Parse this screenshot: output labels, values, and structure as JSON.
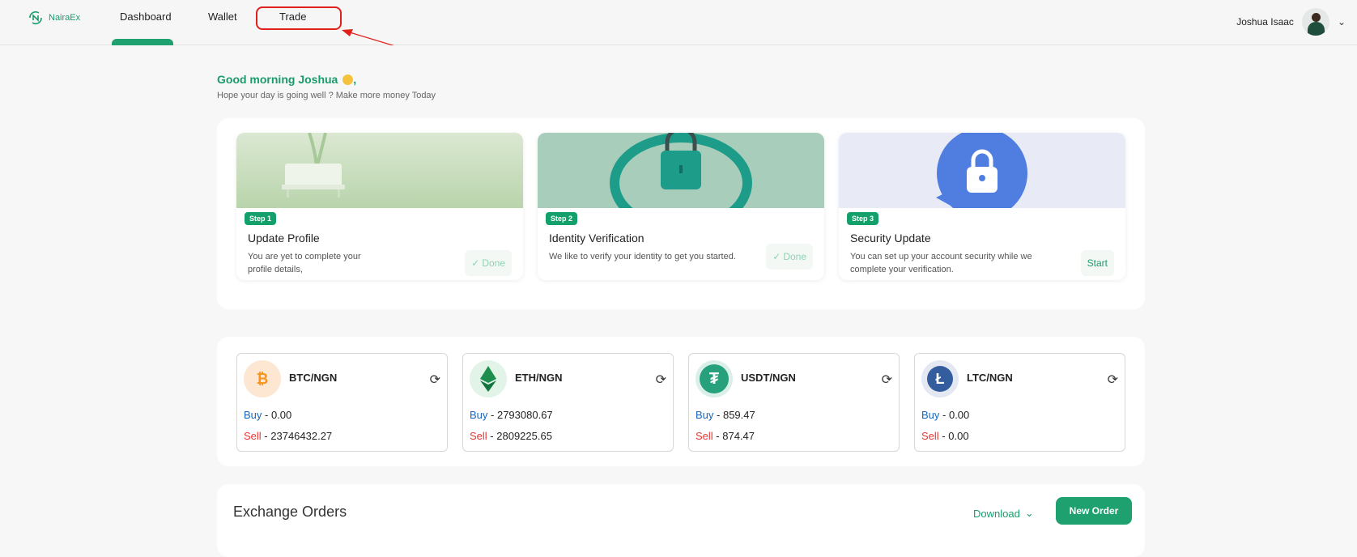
{
  "brand": {
    "name": "NairaEx"
  },
  "nav": {
    "items": [
      {
        "label": "Dashboard"
      },
      {
        "label": "Wallet"
      },
      {
        "label": "Trade"
      }
    ]
  },
  "user": {
    "name": "Joshua Isaac"
  },
  "greeting": {
    "title": "Good morning Joshua",
    "comma": ",",
    "subtitle": "Hope your day is going well ? Make more money Today"
  },
  "steps": [
    {
      "badge": "Step 1",
      "title": "Update Profile",
      "desc_line1": "You are yet to complete your",
      "desc_line2": "profile details,",
      "action": "Done",
      "status": "done"
    },
    {
      "badge": "Step 2",
      "title": "Identity Verification",
      "desc_line1": "We like to verify your identity to get you started.",
      "desc_line2": "",
      "action": "Done",
      "status": "done"
    },
    {
      "badge": "Step 3",
      "title": "Security Update",
      "desc_line1": "You can set up your account security while we",
      "desc_line2": "complete your verification.",
      "action": "Start",
      "status": "pending"
    }
  ],
  "rates": [
    {
      "pair": "BTC/NGN",
      "icon": "bitcoin-icon",
      "buy_label": "Buy",
      "buy": "0.00",
      "sell_label": "Sell",
      "sell": "23746432.27",
      "color": "#f7931a"
    },
    {
      "pair": "ETH/NGN",
      "icon": "ethereum-icon",
      "buy_label": "Buy",
      "buy": "2793080.67",
      "sell_label": "Sell",
      "sell": "2809225.65",
      "color": "#1e8e4e"
    },
    {
      "pair": "USDT/NGN",
      "icon": "tether-icon",
      "buy_label": "Buy",
      "buy": "859.47",
      "sell_label": "Sell",
      "sell": "874.47",
      "color": "#26a17b"
    },
    {
      "pair": "LTC/NGN",
      "icon": "litecoin-icon",
      "buy_label": "Buy",
      "buy": "0.00",
      "sell_label": "Sell",
      "sell": "0.00",
      "color": "#345d9d"
    }
  ],
  "orders": {
    "title": "Exchange Orders",
    "download_label": "Download",
    "new_order_label": "New Order"
  },
  "colors": {
    "accent": "#1fa06f",
    "annotation": "#e0201b",
    "buy": "#1565c0",
    "sell": "#e53935"
  }
}
